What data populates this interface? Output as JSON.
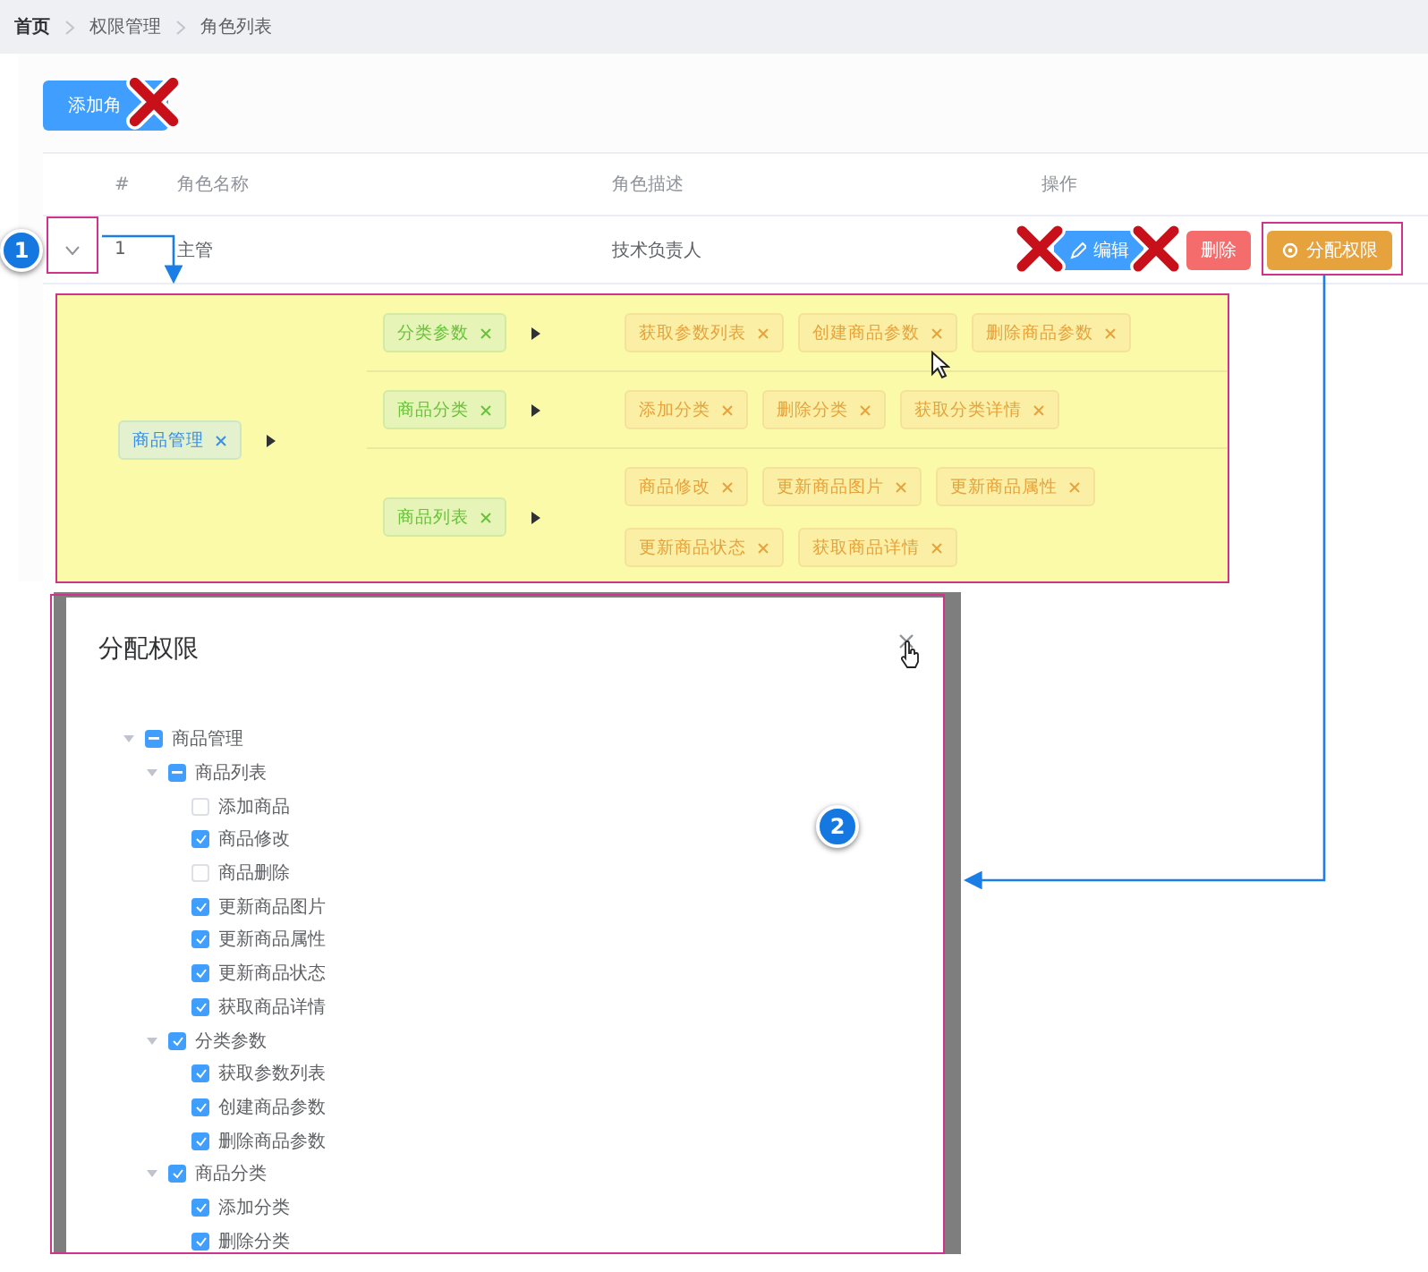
{
  "breadcrumb": [
    "首页",
    "权限管理",
    "角色列表"
  ],
  "add_button": "添加角",
  "table": {
    "columns": [
      "#",
      "角色名称",
      "角色描述",
      "操作"
    ],
    "rows": [
      {
        "expanded": true,
        "index": "1",
        "name": "主管",
        "description": "技术负责人",
        "actions": [
          {
            "kind": "edit",
            "label": "编辑"
          },
          {
            "kind": "delete",
            "label": "删除"
          },
          {
            "kind": "assign",
            "label": "分配权限"
          }
        ],
        "rights": [
          {
            "label": "商品管理",
            "children": [
              {
                "label": "分类参数",
                "children": [
                  {
                    "label": "获取参数列表"
                  },
                  {
                    "label": "创建商品参数"
                  },
                  {
                    "label": "删除商品参数"
                  }
                ]
              },
              {
                "label": "商品分类",
                "children": [
                  {
                    "label": "添加分类"
                  },
                  {
                    "label": "删除分类"
                  },
                  {
                    "label": "获取分类详情"
                  }
                ]
              },
              {
                "label": "商品列表",
                "children": [
                  {
                    "label": "商品修改"
                  },
                  {
                    "label": "更新商品图片"
                  },
                  {
                    "label": "更新商品属性"
                  },
                  {
                    "label": "更新商品状态"
                  },
                  {
                    "label": "获取商品详情"
                  }
                ]
              }
            ]
          }
        ]
      }
    ]
  },
  "dialog": {
    "title": "分配权限",
    "tree": [
      {
        "label": "商品管理",
        "indeterminate": true,
        "expanded": true,
        "children": [
          {
            "label": "商品列表",
            "indeterminate": true,
            "expanded": true,
            "children": [
              {
                "label": "添加商品",
                "checked": false
              },
              {
                "label": "商品修改",
                "checked": true
              },
              {
                "label": "商品删除",
                "checked": false
              },
              {
                "label": "更新商品图片",
                "checked": true
              },
              {
                "label": "更新商品属性",
                "checked": true
              },
              {
                "label": "更新商品状态",
                "checked": true
              },
              {
                "label": "获取商品详情",
                "checked": true
              }
            ]
          },
          {
            "label": "分类参数",
            "checked": true,
            "expanded": true,
            "children": [
              {
                "label": "获取参数列表",
                "checked": true
              },
              {
                "label": "创建商品参数",
                "checked": true
              },
              {
                "label": "删除商品参数",
                "checked": true
              }
            ]
          },
          {
            "label": "商品分类",
            "checked": true,
            "expanded": true,
            "children": [
              {
                "label": "添加分类",
                "checked": true
              },
              {
                "label": "删除分类",
                "checked": true
              }
            ]
          }
        ]
      }
    ]
  },
  "markers": [
    {
      "label": "1"
    },
    {
      "label": "2"
    }
  ]
}
